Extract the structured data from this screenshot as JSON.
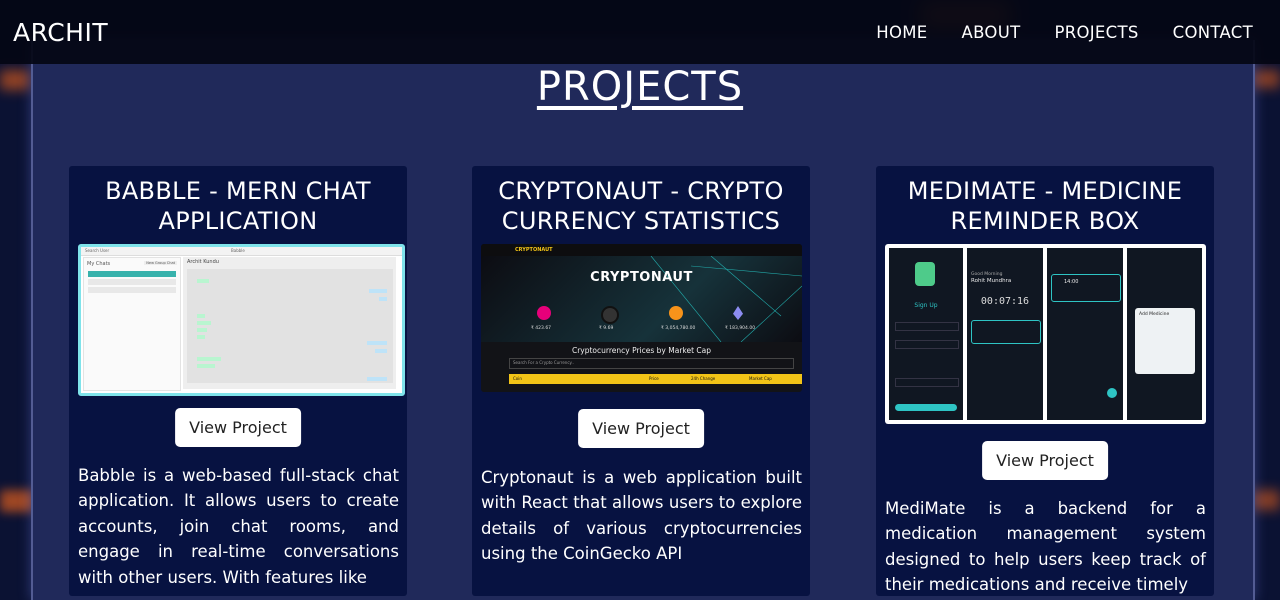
{
  "header": {
    "logo": "ARCHIT",
    "nav": [
      "HOME",
      "ABOUT",
      "PROJECTS",
      "CONTACT"
    ]
  },
  "page": {
    "title": "PROJECTS"
  },
  "projects": [
    {
      "title": "BABBLE - MERN CHAT APPLICATION",
      "button": "View Project",
      "description": "Babble is a web-based full-stack chat application. It allows users to create accounts, join chat rooms, and engage in real-time conversations with other users. With features like",
      "screenshot": {
        "topbar_left": "Search User",
        "topbar_center": "Babble",
        "sidebar_title": "My Chats",
        "sidebar_button": "New Group Chat",
        "chat_header": "Archit Kundu"
      }
    },
    {
      "title": "CRYPTONAUT - CRYPTO CURRENCY STATISTICS",
      "button": "View Project",
      "description": "Cryptonaut is a web application built with React that allows users to explore details of various cryptocurrencies using the CoinGecko API",
      "screenshot": {
        "brand": "CRYPTONAUT",
        "hero": "CRYPTONAUT",
        "tagline": "Cryptocurrency Prices by Market Cap",
        "coins": [
          {
            "symbol": "DOT",
            "price": "₹ 423.67"
          },
          {
            "symbol": "XLM",
            "price": "₹ 9.69"
          },
          {
            "symbol": "BTC",
            "price": "₹ 3,054,780.00"
          },
          {
            "symbol": "ETH",
            "price": "₹ 183,904.00"
          }
        ],
        "search_placeholder": "Search For a Crypto Currency..",
        "table_headers": [
          "Coin",
          "Price",
          "24h Change",
          "Market Cap"
        ]
      }
    },
    {
      "title": "MEDIMATE - MEDICINE REMINDER BOX",
      "button": "View Project",
      "description": "MediMate is a backend for a medication management system designed to help users keep track of their medications and receive timely",
      "screenshot": {
        "screen1_title": "Sign Up",
        "screen2_greeting": "Good Morning",
        "screen2_name": "Rohit Mundhra",
        "screen2_timer": "00:07:16",
        "screen3_time": "14:00",
        "screen4_title": "Add Medicine"
      }
    }
  ],
  "colors": {
    "background": "#20295a",
    "card": "#071241",
    "accent_teal": "#2ec4c4",
    "crypto_yellow": "#f2c417"
  }
}
